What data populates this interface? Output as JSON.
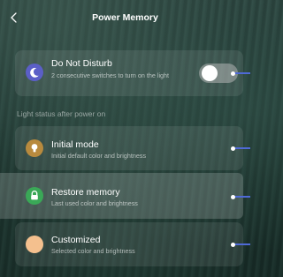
{
  "header": {
    "title": "Power Memory",
    "back_icon": "chevron-left-icon"
  },
  "dnd": {
    "title": "Do Not Disturb",
    "description": "2 consecutive switches to turn on the light",
    "icon": "moon-icon",
    "icon_color": "#5b5fc7",
    "toggle_on": false
  },
  "section_label": "Light status after power on",
  "modes": [
    {
      "title": "Initial mode",
      "description": "Initial default color and brightness",
      "icon": "lightbulb-icon",
      "icon_color": "#b88a3e",
      "selected": false
    },
    {
      "title": "Restore memory",
      "description": "Last used color and brightness",
      "icon": "lock-icon",
      "icon_color": "#3aa857",
      "selected": true
    },
    {
      "title": "Customized",
      "description": "Selected color and brightness",
      "icon": "color-swatch-icon",
      "icon_color": "#f4c08e",
      "selected": false
    }
  ],
  "accent_color": "#4f6ad6"
}
